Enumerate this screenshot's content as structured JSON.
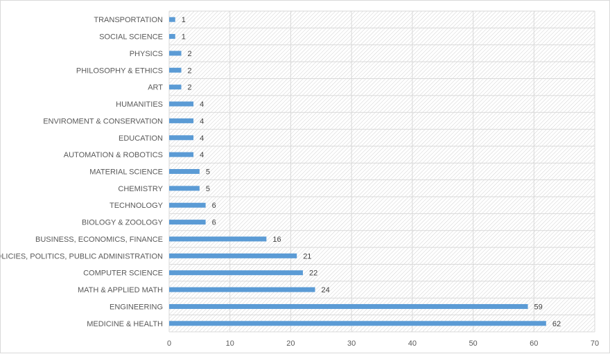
{
  "chart_data": {
    "type": "bar",
    "orientation": "horizontal",
    "title": "",
    "xlabel": "",
    "ylabel": "",
    "categories": [
      "MEDICINE & HEALTH",
      "ENGINEERING",
      "MATH & APPLIED MATH",
      "COMPUTER SCIENCE",
      "POLICIES, POLITICS, PUBLIC ADMINISTRATION",
      "BUSINESS, ECONOMICS, FINANCE",
      "BIOLOGY & ZOOLOGY",
      "TECHNOLOGY",
      "CHEMISTRY",
      "MATERIAL SCIENCE",
      "AUTOMATION & ROBOTICS",
      "EDUCATION",
      "ENVIROMENT & CONSERVATION",
      "HUMANITIES",
      "ART",
      "PHILOSOPHY & ETHICS",
      "PHYSICS",
      "SOCIAL SCIENCE",
      "TRANSPORTATION"
    ],
    "values": [
      62,
      59,
      24,
      22,
      21,
      16,
      6,
      6,
      5,
      5,
      4,
      4,
      4,
      4,
      2,
      2,
      2,
      1,
      1
    ],
    "xlim": [
      0,
      70
    ],
    "x_ticks": [
      0,
      10,
      20,
      30,
      40,
      50,
      60,
      70
    ],
    "x_tick_labels": [
      "0",
      "10",
      "20",
      "30",
      "40",
      "50",
      "60",
      "70"
    ],
    "grid": true,
    "legend": "none",
    "data_labels": true,
    "bar_color": "#5b9bd5",
    "plot_background": "hatched-diagonal"
  }
}
